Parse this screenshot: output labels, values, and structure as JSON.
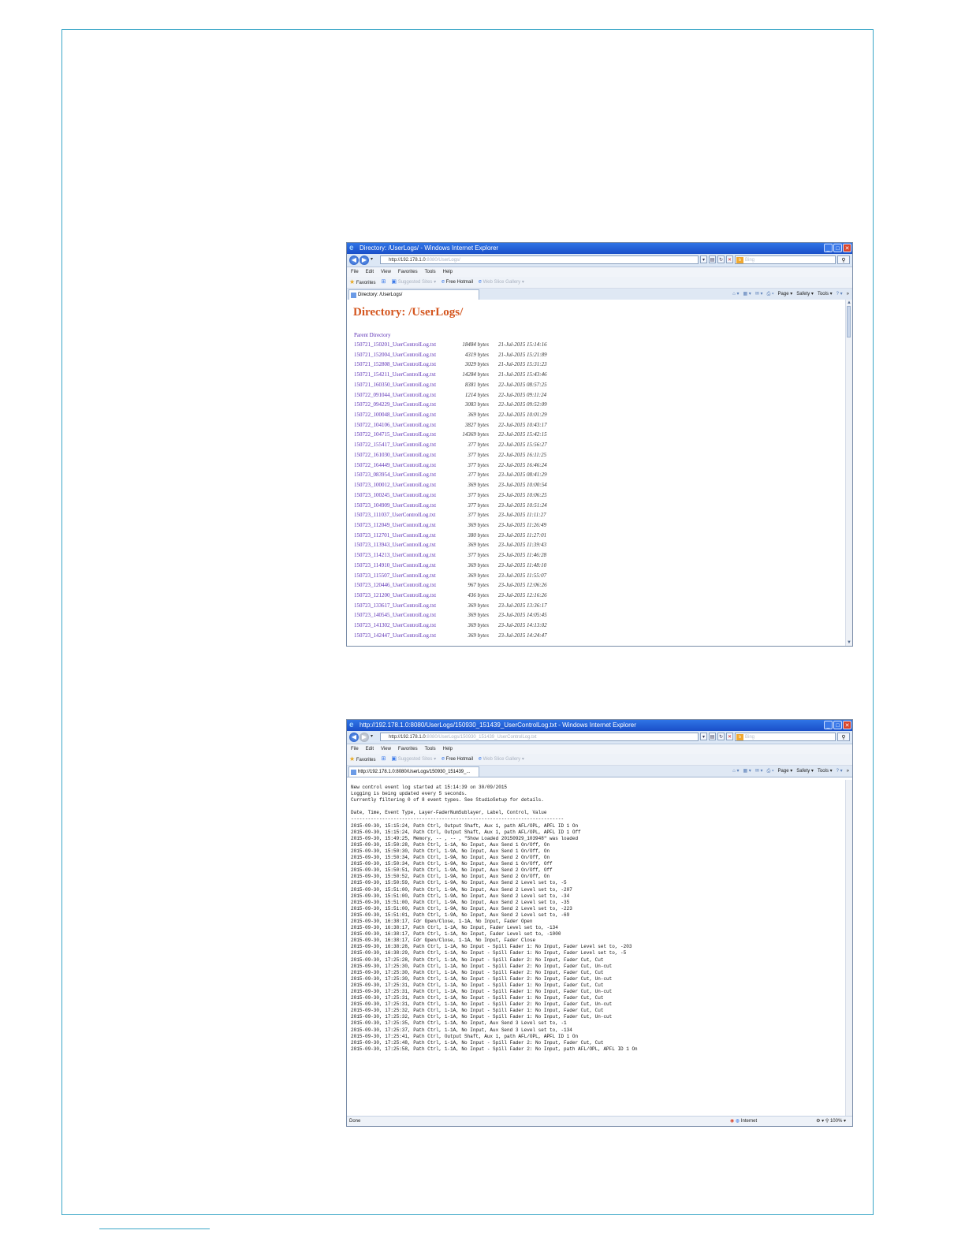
{
  "window1": {
    "title": "Directory: /UserLogs/ - Windows Internet Explorer",
    "address": "http://192.178.1.0",
    "address_faded": ":8080/UserLogs/",
    "search_placeholder": "Bing",
    "menu": [
      "File",
      "Edit",
      "View",
      "Favorites",
      "Tools",
      "Help"
    ],
    "favorites": {
      "label": "Favorites",
      "suggested": "Suggested Sites ▾",
      "hotmail": "Free Hotmail",
      "slice": "Web Slice Gallery ▾"
    },
    "tab_label": "Directory: /UserLogs/",
    "commands": {
      "page": "Page ▾",
      "safety": "Safety ▾",
      "tools": "Tools ▾"
    },
    "heading": "Directory: /UserLogs/",
    "parent_link": "Parent Directory",
    "files": [
      {
        "name": "150721_150201_UserControlLog.txt",
        "size": "18484 bytes",
        "date": "21-Jul-2015 15:14:16"
      },
      {
        "name": "150721_152004_UserControlLog.txt",
        "size": "4319 bytes",
        "date": "21-Jul-2015 15:21:89"
      },
      {
        "name": "150721_152808_UserControlLog.txt",
        "size": "3029 bytes",
        "date": "21-Jul-2015 15:31:23"
      },
      {
        "name": "150721_154211_UserControlLog.txt",
        "size": "14284 bytes",
        "date": "21-Jul-2015 15:43:46"
      },
      {
        "name": "150721_160350_UserControlLog.txt",
        "size": "8381 bytes",
        "date": "22-Jul-2015 08:57:25"
      },
      {
        "name": "150722_091044_UserControlLog.txt",
        "size": "1214 bytes",
        "date": "22-Jul-2015 09:11:24"
      },
      {
        "name": "150722_094229_UserControlLog.txt",
        "size": "3083 bytes",
        "date": "22-Jul-2015 09:52:09"
      },
      {
        "name": "150722_100048_UserControlLog.txt",
        "size": "369 bytes",
        "date": "22-Jul-2015 10:01:29"
      },
      {
        "name": "150722_104106_UserControlLog.txt",
        "size": "3827 bytes",
        "date": "22-Jul-2015 10:43:17"
      },
      {
        "name": "150722_104715_UserControlLog.txt",
        "size": "14369 bytes",
        "date": "22-Jul-2015 15:42:15"
      },
      {
        "name": "150722_155417_UserControlLog.txt",
        "size": "377 bytes",
        "date": "22-Jul-2015 15:56:27"
      },
      {
        "name": "150722_161030_UserControlLog.txt",
        "size": "377 bytes",
        "date": "22-Jul-2015 16:11:25"
      },
      {
        "name": "150722_164449_UserControlLog.txt",
        "size": "377 bytes",
        "date": "22-Jul-2015 16:46:24"
      },
      {
        "name": "150723_083954_UserControlLog.txt",
        "size": "377 bytes",
        "date": "23-Jul-2015 08:41:29"
      },
      {
        "name": "150723_100012_UserControlLog.txt",
        "size": "369 bytes",
        "date": "23-Jul-2015 10:00:54"
      },
      {
        "name": "150723_100245_UserControlLog.txt",
        "size": "377 bytes",
        "date": "23-Jul-2015 10:06:25"
      },
      {
        "name": "150723_104909_UserControlLog.txt",
        "size": "377 bytes",
        "date": "23-Jul-2015 10:51:24"
      },
      {
        "name": "150723_111037_UserControlLog.txt",
        "size": "377 bytes",
        "date": "23-Jul-2015 11:11:27"
      },
      {
        "name": "150723_112049_UserControlLog.txt",
        "size": "369 bytes",
        "date": "23-Jul-2015 11:26:49"
      },
      {
        "name": "150723_112701_UserControlLog.txt",
        "size": "380 bytes",
        "date": "23-Jul-2015 11:27:01"
      },
      {
        "name": "150723_113943_UserControlLog.txt",
        "size": "369 bytes",
        "date": "23-Jul-2015 11:39:43"
      },
      {
        "name": "150723_114213_UserControlLog.txt",
        "size": "377 bytes",
        "date": "23-Jul-2015 11:46:28"
      },
      {
        "name": "150723_114910_UserControlLog.txt",
        "size": "369 bytes",
        "date": "23-Jul-2015 11:48:10"
      },
      {
        "name": "150723_115507_UserControlLog.txt",
        "size": "369 bytes",
        "date": "23-Jul-2015 11:55:07"
      },
      {
        "name": "150723_120446_UserControlLog.txt",
        "size": "967 bytes",
        "date": "23-Jul-2015 12:06:26"
      },
      {
        "name": "150723_121200_UserControlLog.txt",
        "size": "436 bytes",
        "date": "23-Jul-2015 12:16:26"
      },
      {
        "name": "150723_133617_UserControlLog.txt",
        "size": "369 bytes",
        "date": "23-Jul-2015 13:36:17"
      },
      {
        "name": "150723_140545_UserControlLog.txt",
        "size": "369 bytes",
        "date": "23-Jul-2015 14:05:45"
      },
      {
        "name": "150723_141302_UserControlLog.txt",
        "size": "369 bytes",
        "date": "23-Jul-2015 14:13:02"
      },
      {
        "name": "150723_142447_UserControlLog.txt",
        "size": "369 bytes",
        "date": "23-Jul-2015 14:24:47"
      }
    ]
  },
  "window2": {
    "title": "http://192.178.1.0:8080/UserLogs/150930_151439_UserControlLog.txt - Windows Internet Explorer",
    "address": "http://192.178.1.0",
    "address_faded": ":8080/UserLogs/150930_151439_UserControlLog.txt",
    "search_placeholder": "Bing",
    "menu": [
      "File",
      "Edit",
      "View",
      "Favorites",
      "Tools",
      "Help"
    ],
    "favorites": {
      "label": "Favorites",
      "suggested": "Suggested Sites ▾",
      "hotmail": "Free Hotmail",
      "slice": "Web Slice Gallery ▾"
    },
    "tab_label": "http://192.178.1.0:8080/UserLogs/150930_151439_...",
    "commands": {
      "page": "Page ▾",
      "safety": "Safety ▾",
      "tools": "Tools ▾"
    },
    "log_lines": [
      "New control event log started at 15:14:39 on 30/09/2015",
      "Logging is being updated every 5 seconds.",
      "Currently filtering 0 of 8 event types. See StudioSetup for details.",
      "",
      "Date, Time, Event Type, Layer-FaderNumSublayer, Label, Control, Value",
      "---------------------------------------------------------------------------",
      "2015-09-30, 15:15:24, Path Ctrl, Output Shaft, Aux 1, path AFL/OPL, APFL ID 1 On",
      "2015-09-30, 15:15:24, Path Ctrl, Output Shaft, Aux 1, path AFL/OPL, APFL ID 1 Off",
      "2015-09-30, 15:49:25, Memory, -- , -- , \"Show Loaded 20150929_103948\" was loaded",
      "2015-09-30, 15:50:28, Path Ctrl, 1-1A, No Input, Aux Send 1 On/Off, On",
      "2015-09-30, 15:50:30, Path Ctrl, 1-9A, No Input, Aux Send 1 On/Off, On",
      "2015-09-30, 15:50:34, Path Ctrl, 1-9A, No Input, Aux Send 2 On/Off, On",
      "2015-09-30, 15:50:34, Path Ctrl, 1-9A, No Input, Aux Send 1 On/Off, Off",
      "2015-09-30, 15:50:51, Path Ctrl, 1-9A, No Input, Aux Send 2 On/Off, Off",
      "2015-09-30, 15:50:52, Path Ctrl, 1-9A, No Input, Aux Send 2 On/Off, On",
      "2015-09-30, 15:50:59, Path Ctrl, 1-9A, No Input, Aux Send 2 Level set to, -5",
      "2015-09-30, 15:51:00, Path Ctrl, 1-9A, No Input, Aux Send 2 Level set to, -207",
      "2015-09-30, 15:51:00, Path Ctrl, 1-9A, No Input, Aux Send 2 Level set to, -34",
      "2015-09-30, 15:51:00, Path Ctrl, 1-9A, No Input, Aux Send 2 Level set to, -35",
      "2015-09-30, 15:51:00, Path Ctrl, 1-9A, No Input, Aux Send 2 Level set to, -223",
      "2015-09-30, 15:51:01, Path Ctrl, 1-9A, No Input, Aux Send 2 Level set to, -69",
      "2015-09-30, 16:38:17, Fdr Open/Close, 1-1A, No Input, Fader Open",
      "2015-09-30, 16:38:17, Path Ctrl, 1-1A, No Input, Fader Level set to, -134",
      "2015-09-30, 16:38:17, Path Ctrl, 1-1A, No Input, Fader Level set to, -1000",
      "2015-09-30, 16:38:17, Fdr Open/Close, 1-1A, No Input, Fader Close",
      "2015-09-30, 16:38:28, Path Ctrl, 1-1A, No Input - Spill Fader 1: No Input, Fader Level set to, -203",
      "2015-09-30, 16:38:29, Path Ctrl, 1-1A, No Input - Spill Fader 1: No Input, Fader Level set to, -5",
      "2015-09-30, 17:25:28, Path Ctrl, 1-1A, No Input - Spill Fader 2: No Input, Fader Cut, Cut",
      "2015-09-30, 17:25:30, Path Ctrl, 1-1A, No Input - Spill Fader 2: No Input, Fader Cut, Un-cut",
      "2015-09-30, 17:25:30, Path Ctrl, 1-1A, No Input - Spill Fader 2: No Input, Fader Cut, Cut",
      "2015-09-30, 17:25:30, Path Ctrl, 1-1A, No Input - Spill Fader 2: No Input, Fader Cut, Un-cut",
      "2015-09-30, 17:25:31, Path Ctrl, 1-1A, No Input - Spill Fader 1: No Input, Fader Cut, Cut",
      "2015-09-30, 17:25:31, Path Ctrl, 1-1A, No Input - Spill Fader 1: No Input, Fader Cut, Un-cut",
      "2015-09-30, 17:25:31, Path Ctrl, 1-1A, No Input - Spill Fader 1: No Input, Fader Cut, Cut",
      "2015-09-30, 17:25:31, Path Ctrl, 1-1A, No Input - Spill Fader 2: No Input, Fader Cut, Un-cut",
      "2015-09-30, 17:25:32, Path Ctrl, 1-1A, No Input - Spill Fader 1: No Input, Fader Cut, Cut",
      "2015-09-30, 17:25:32, Path Ctrl, 1-1A, No Input - Spill Fader 1: No Input, Fader Cut, Un-cut",
      "2015-09-30, 17:25:35, Path Ctrl, 1-1A, No Input, Aux Send 3 Level set to, -1",
      "2015-09-30, 17:25:37, Path Ctrl, 1-1A, No Input, Aux Send 3 Level set to, -134",
      "2015-09-30, 17:25:41, Path Ctrl, Output Shaft, Aux 1, path AFL/OPL, APFL ID 1 On",
      "2015-09-30, 17:25:48, Path Ctrl, 1-1A, No Input - Spill Fader 2: No Input, Fader Cut, Cut",
      "2015-09-30, 17:25:58, Path Ctrl, 1-1A, No Input - Spill Fader 2: No Input, path AFL/OPL, APFL ID 1 On"
    ],
    "status": {
      "done": "Done",
      "zone": "Internet",
      "zoom": "100%"
    }
  }
}
